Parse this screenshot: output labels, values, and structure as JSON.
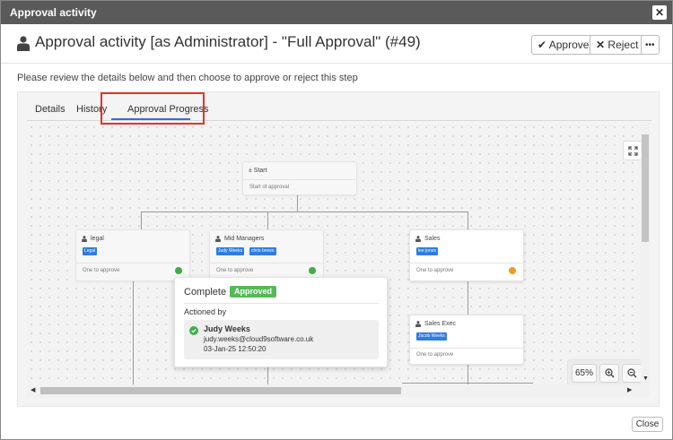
{
  "window": {
    "title": "Approval activity"
  },
  "header": {
    "title": "Approval activity [as Administrator] - \"Full Approval\" (#49)",
    "approve_label": "Approve",
    "reject_label": "Reject",
    "more_label": "•••"
  },
  "intro_text": "Please review the details below and then choose to approve or reject this step",
  "tabs": [
    {
      "label": "Details"
    },
    {
      "label": "History"
    },
    {
      "label": "Approval Progress",
      "active": true
    }
  ],
  "flow": {
    "start": {
      "title": "Start",
      "subtitle": "Start of approval"
    },
    "nodes": [
      {
        "title": "legal",
        "chips": [
          "Legal"
        ],
        "rule": "One to approve",
        "status": "approved"
      },
      {
        "title": "Mid Managers",
        "chips": [
          "Judy Weeks",
          "chris brown"
        ],
        "rule": "One to approve",
        "status": "approved"
      },
      {
        "title": "Sales",
        "chips": [
          "lee jones"
        ],
        "rule": "One to approve",
        "status": "pending"
      },
      {
        "title": "Sales Exec",
        "chips": [
          "Jacob Weeks"
        ],
        "rule": "One to approve",
        "status": "none"
      }
    ]
  },
  "zoom": {
    "level": "65%",
    "zoom_in_label": "+",
    "zoom_out_label": "−"
  },
  "popup": {
    "status_label": "Complete",
    "badge": "Approved",
    "actioned_by_label": "Actioned by",
    "person_name": "Judy Weeks",
    "person_email": "judy.weeks@cloud9software.co.uk",
    "timestamp": "03-Jan-25 12:50:20"
  },
  "footer": {
    "close_label": "Close"
  },
  "colors": {
    "accent": "#2f6fd8",
    "success": "#3fae49",
    "pending": "#f19a1f",
    "highlight": "#e0352b",
    "chip": "#2f7de1"
  }
}
